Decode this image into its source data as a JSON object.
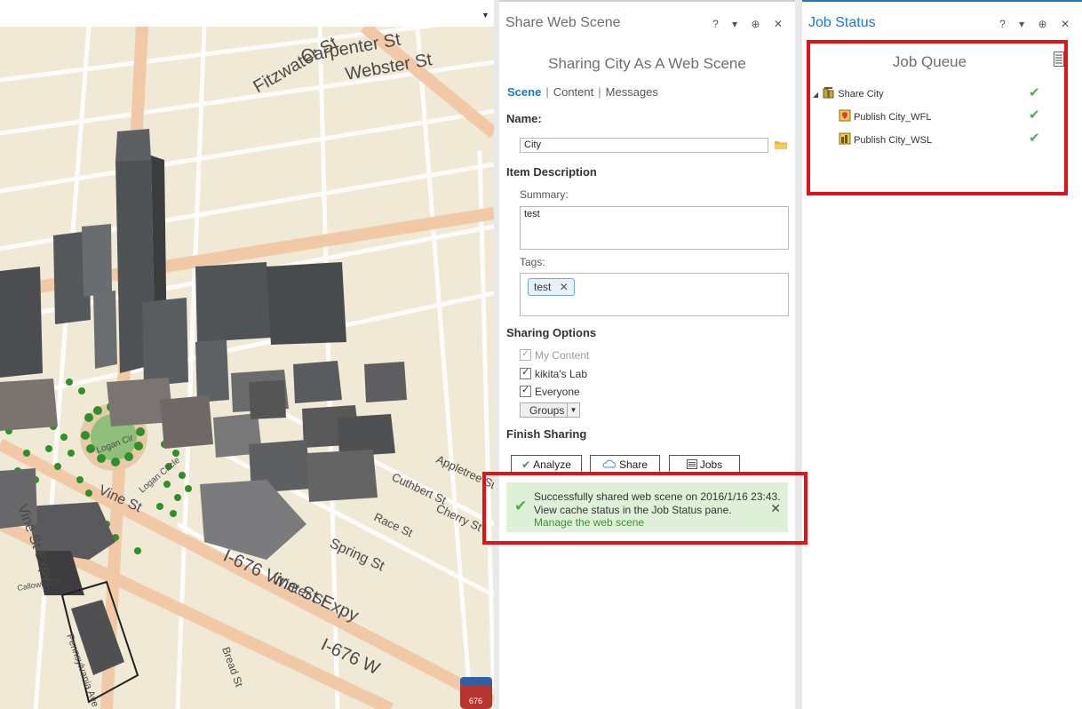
{
  "scene": {
    "street_labels": [
      "Carpenter St",
      "Webster St",
      "Fitzwater St",
      "Vine St Expy",
      "I-676 Vine St Expy",
      "Winter St",
      "Spring St",
      "Race St",
      "Cherry St",
      "Appletree St",
      "Cuthbert St",
      "Pennsylvania Ave",
      "Logan Cir",
      "Logan Circle",
      "Callowhill St",
      "Bread St",
      "I-676 W",
      "Vine St"
    ],
    "interstate_shield": "676"
  },
  "share_pane": {
    "title": "Share Web Scene",
    "controls": [
      "?",
      "▾",
      "⊕",
      "✕"
    ],
    "subtitle": "Sharing City As A Web Scene",
    "tabs": [
      {
        "label": "Scene",
        "active": true
      },
      {
        "label": "Content",
        "active": false
      },
      {
        "label": "Messages",
        "active": false
      }
    ],
    "name_label": "Name:",
    "name_value": "City",
    "item_description_label": "Item Description",
    "summary_label": "Summary:",
    "summary_value": "test",
    "tags_label": "Tags:",
    "tags": [
      "test"
    ],
    "sharing_options_label": "Sharing Options",
    "sharing_options": [
      {
        "label": "My Content",
        "checked": true,
        "disabled": true
      },
      {
        "label": "kikita's Lab",
        "checked": true,
        "disabled": false
      },
      {
        "label": "Everyone",
        "checked": true,
        "disabled": false
      }
    ],
    "groups_button": "Groups",
    "finish_sharing_label": "Finish Sharing",
    "buttons": {
      "analyze": "Analyze",
      "share": "Share",
      "jobs": "Jobs"
    },
    "success": {
      "line1": "Successfully shared web scene on 2016/1/16 23:43.",
      "line2": "View cache status in the Job Status pane.",
      "link": "Manage the web scene"
    }
  },
  "job_pane": {
    "title": "Job Status",
    "controls": [
      "?",
      "▾",
      "⊕",
      "✕"
    ],
    "queue_title": "Job Queue",
    "jobs": [
      {
        "label": "Share City",
        "status": "complete",
        "level": 0
      },
      {
        "label": "Publish City_WFL",
        "status": "complete",
        "level": 1
      },
      {
        "label": "Publish City_WSL",
        "status": "complete",
        "level": 1
      }
    ]
  },
  "colors": {
    "accent": "#1a7bc9",
    "highlight": "#e2121a",
    "success_bg": "#dff0d8",
    "success_check": "#4caf50"
  }
}
